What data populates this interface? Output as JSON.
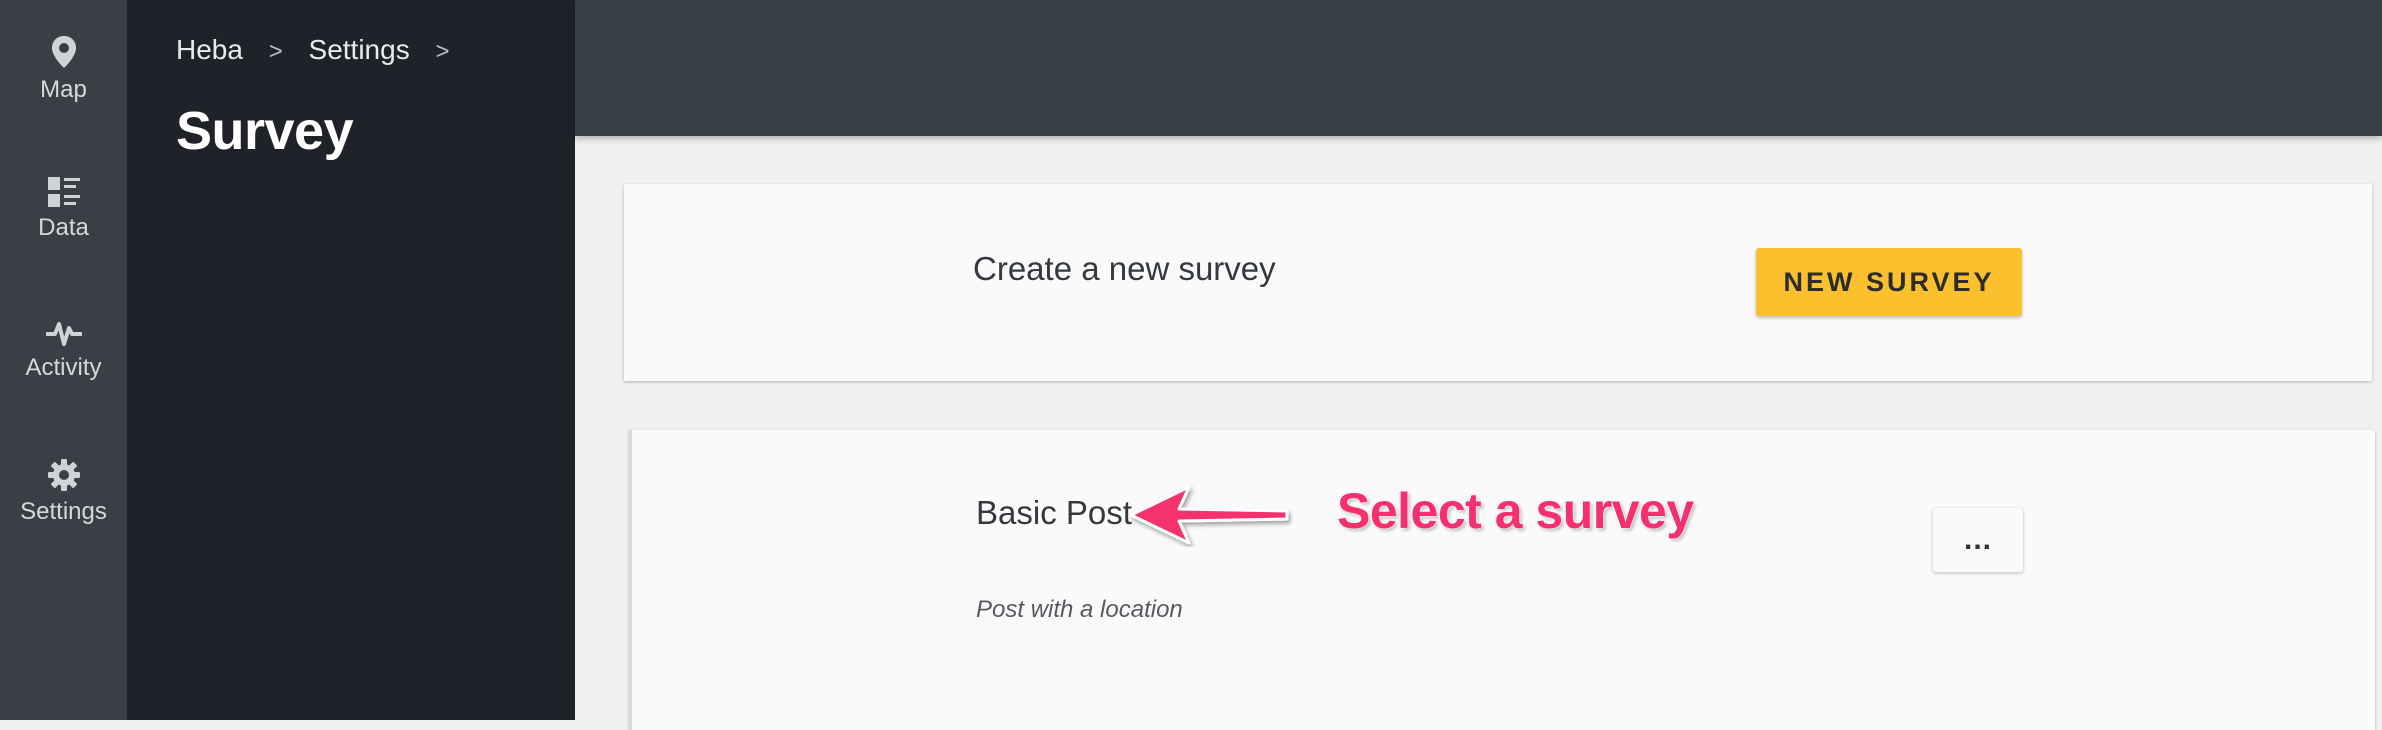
{
  "nav": {
    "items": [
      {
        "label": "Map",
        "icon": "map-pin-icon"
      },
      {
        "label": "Data",
        "icon": "data-list-icon"
      },
      {
        "label": "Activity",
        "icon": "activity-pulse-icon"
      },
      {
        "label": "Settings",
        "icon": "gear-icon"
      }
    ]
  },
  "breadcrumb": {
    "items": [
      "Heba",
      "Settings"
    ],
    "separator": ">"
  },
  "page": {
    "title": "Survey"
  },
  "create_card": {
    "text": "Create a new survey",
    "button_label": "NEW SURVEY"
  },
  "surveys": [
    {
      "title": "Basic Post",
      "description": "Post with a location",
      "menu_label": "..."
    }
  ],
  "annotation": {
    "text": "Select a survey"
  },
  "colors": {
    "rail_bg": "#3a3f46",
    "subnav_bg": "#1f2329",
    "topbar_bg": "#373e47",
    "button_accent": "#fbc02d",
    "annotation": "#f5306e"
  }
}
